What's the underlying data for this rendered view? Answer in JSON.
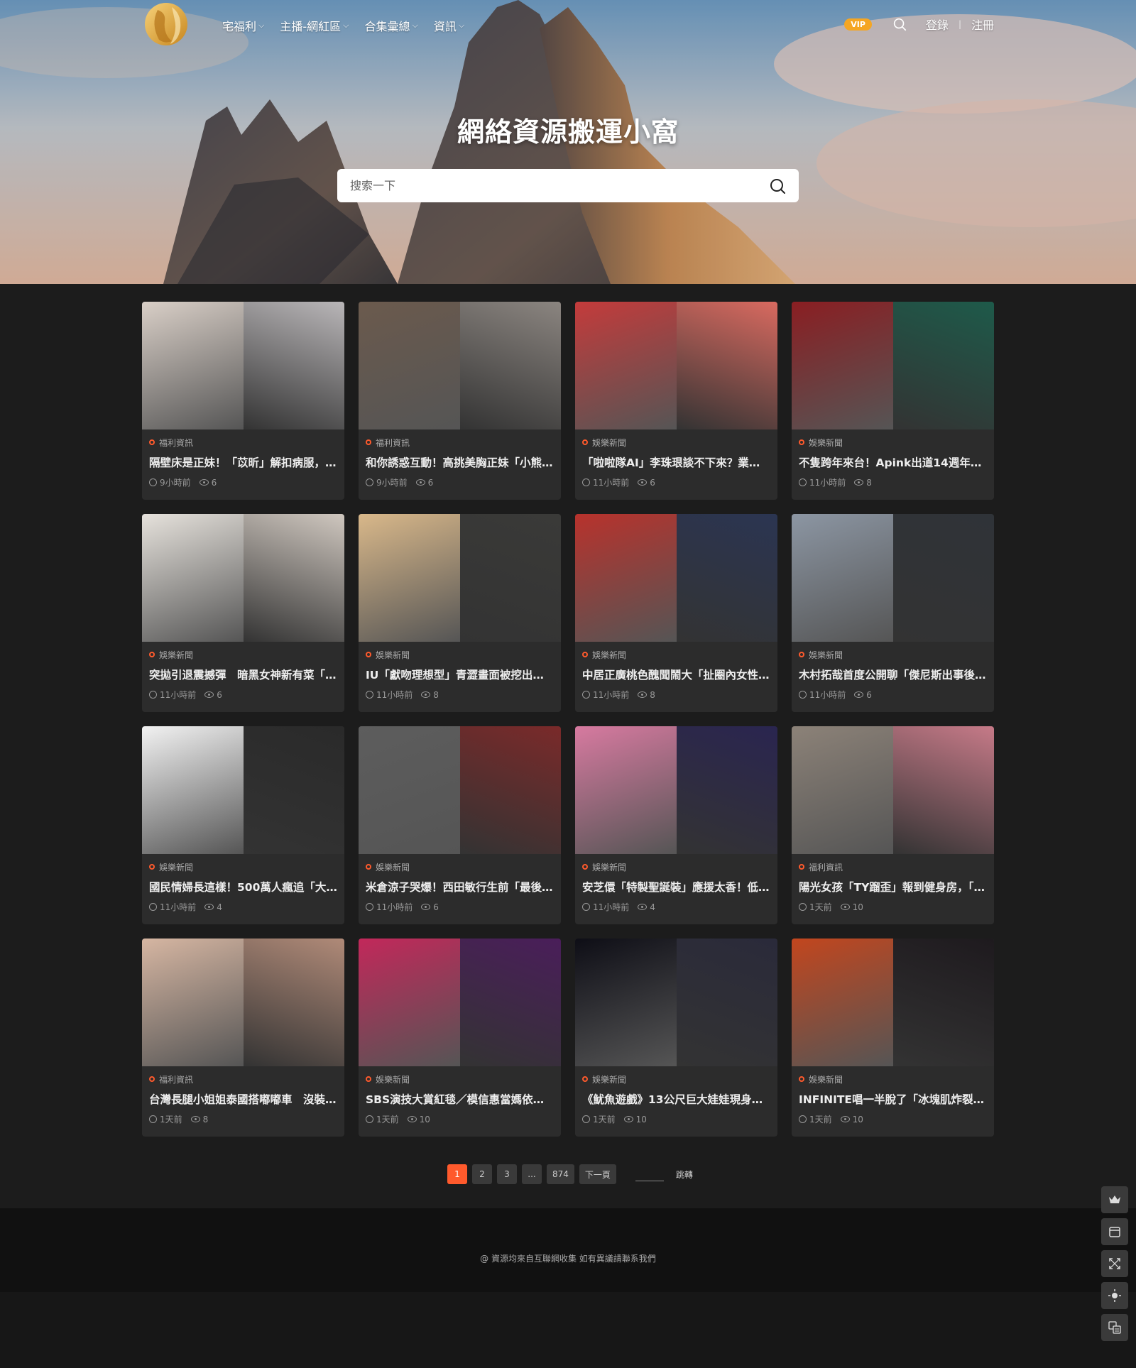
{
  "nav": {
    "menu": [
      {
        "label": "宅福利"
      },
      {
        "label": "主播-網紅區"
      },
      {
        "label": "合集彙總"
      },
      {
        "label": "資訊"
      }
    ],
    "vip_label": "VIP",
    "login_label": "登錄",
    "register_label": "注冊"
  },
  "hero": {
    "title": "網絡資源搬運小窩",
    "search_placeholder": "搜索一下"
  },
  "posts": [
    {
      "category": "福利資訊",
      "title": "隔壁床是正妹！「苡昕」解扣病服，…",
      "time": "9小時前",
      "views": "6",
      "colors": [
        "#d9cfc7",
        "#b9b6b8"
      ]
    },
    {
      "category": "福利資訊",
      "title": "和你誘惑互動！高挑美胸正妹「小熊…",
      "time": "9小時前",
      "views": "6",
      "colors": [
        "#6b5a4d",
        "#8b8580"
      ]
    },
    {
      "category": "娛樂新聞",
      "title": "「啦啦隊AI」李珠珢談不下來？業界…",
      "time": "11小時前",
      "views": "6",
      "colors": [
        "#c43b3b",
        "#d96a60"
      ]
    },
    {
      "category": "娛樂新聞",
      "title": "不隻跨年來台！Apink出道14週年「…",
      "time": "11小時前",
      "views": "8",
      "colors": [
        "#8a1e22",
        "#1e5a4a"
      ]
    },
    {
      "category": "娛樂新聞",
      "title": "突拋引退震撼彈　暗黑女神新有菜「…",
      "time": "11小時前",
      "views": "6",
      "colors": [
        "#e6e2dc",
        "#cfc7bf"
      ]
    },
    {
      "category": "娛樂新聞",
      "title": "IU「獻吻理想型」青澀畫面被挖出！…",
      "time": "11小時前",
      "views": "8",
      "colors": [
        "#d9b88a",
        "#3a3a38"
      ]
    },
    {
      "category": "娛樂新聞",
      "title": "中居正廣桃色醜聞鬧大「扯圈內女性…",
      "time": "11小時前",
      "views": "8",
      "colors": [
        "#b8322c",
        "#2b3552"
      ]
    },
    {
      "category": "娛樂新聞",
      "title": "木村拓哉首度公開聊「傑尼斯出事後…",
      "time": "11小時前",
      "views": "6",
      "colors": [
        "#8c96a3",
        "#2f3338"
      ]
    },
    {
      "category": "娛樂新聞",
      "title": "國民情婦長這樣！500萬人瘋追「大…",
      "time": "11小時前",
      "views": "4",
      "colors": [
        "#f2f2f2",
        "#2a2a2a"
      ]
    },
    {
      "category": "娛樂新聞",
      "title": "米倉涼子哭爆！西田敏行生前「最後…",
      "time": "11小時前",
      "views": "6",
      "colors": [
        "#5d5d5d",
        "#7a2a2a"
      ]
    },
    {
      "category": "娛樂新聞",
      "title": "安芝儇「特製聖誕裝」應援太香！低…",
      "time": "11小時前",
      "views": "4",
      "colors": [
        "#d77aa0",
        "#2a2550"
      ]
    },
    {
      "category": "福利資訊",
      "title": "陽光女孩「TY蹓歪」報到健身房，「…",
      "time": "1天前",
      "views": "10",
      "colors": [
        "#8c8278",
        "#c67a88"
      ]
    },
    {
      "category": "福利資訊",
      "title": "台灣長腿小姐姐泰國搭嘟嘟車　沒裝…",
      "time": "1天前",
      "views": "8",
      "colors": [
        "#d6b6a2",
        "#b08a78"
      ]
    },
    {
      "category": "娛樂新聞",
      "title": "SBS演技大賞紅毯／模信惠當媽依舊…",
      "time": "1天前",
      "views": "10",
      "colors": [
        "#c2285a",
        "#4a1e5a"
      ]
    },
    {
      "category": "娛樂新聞",
      "title": "《魷魚遊戲》13公尺巨大娃娃現身高…",
      "time": "1天前",
      "views": "10",
      "colors": [
        "#0e0e16",
        "#2a2a3a"
      ]
    },
    {
      "category": "娛樂新聞",
      "title": "INFINITE唱一半脫了「冰塊肌炸裂」…",
      "time": "1天前",
      "views": "10",
      "colors": [
        "#c2461e",
        "#1e1a1e"
      ]
    }
  ],
  "pagination": {
    "pages": [
      "1",
      "2",
      "3",
      "...",
      "874"
    ],
    "next_label": "下一頁",
    "jump_label": "跳轉"
  },
  "footer": {
    "text": "@ 資源均來自互聯網收集 如有異議請聯系我們"
  },
  "theme": {
    "accent": "#ff5a2c",
    "vip": "#f5a623"
  }
}
